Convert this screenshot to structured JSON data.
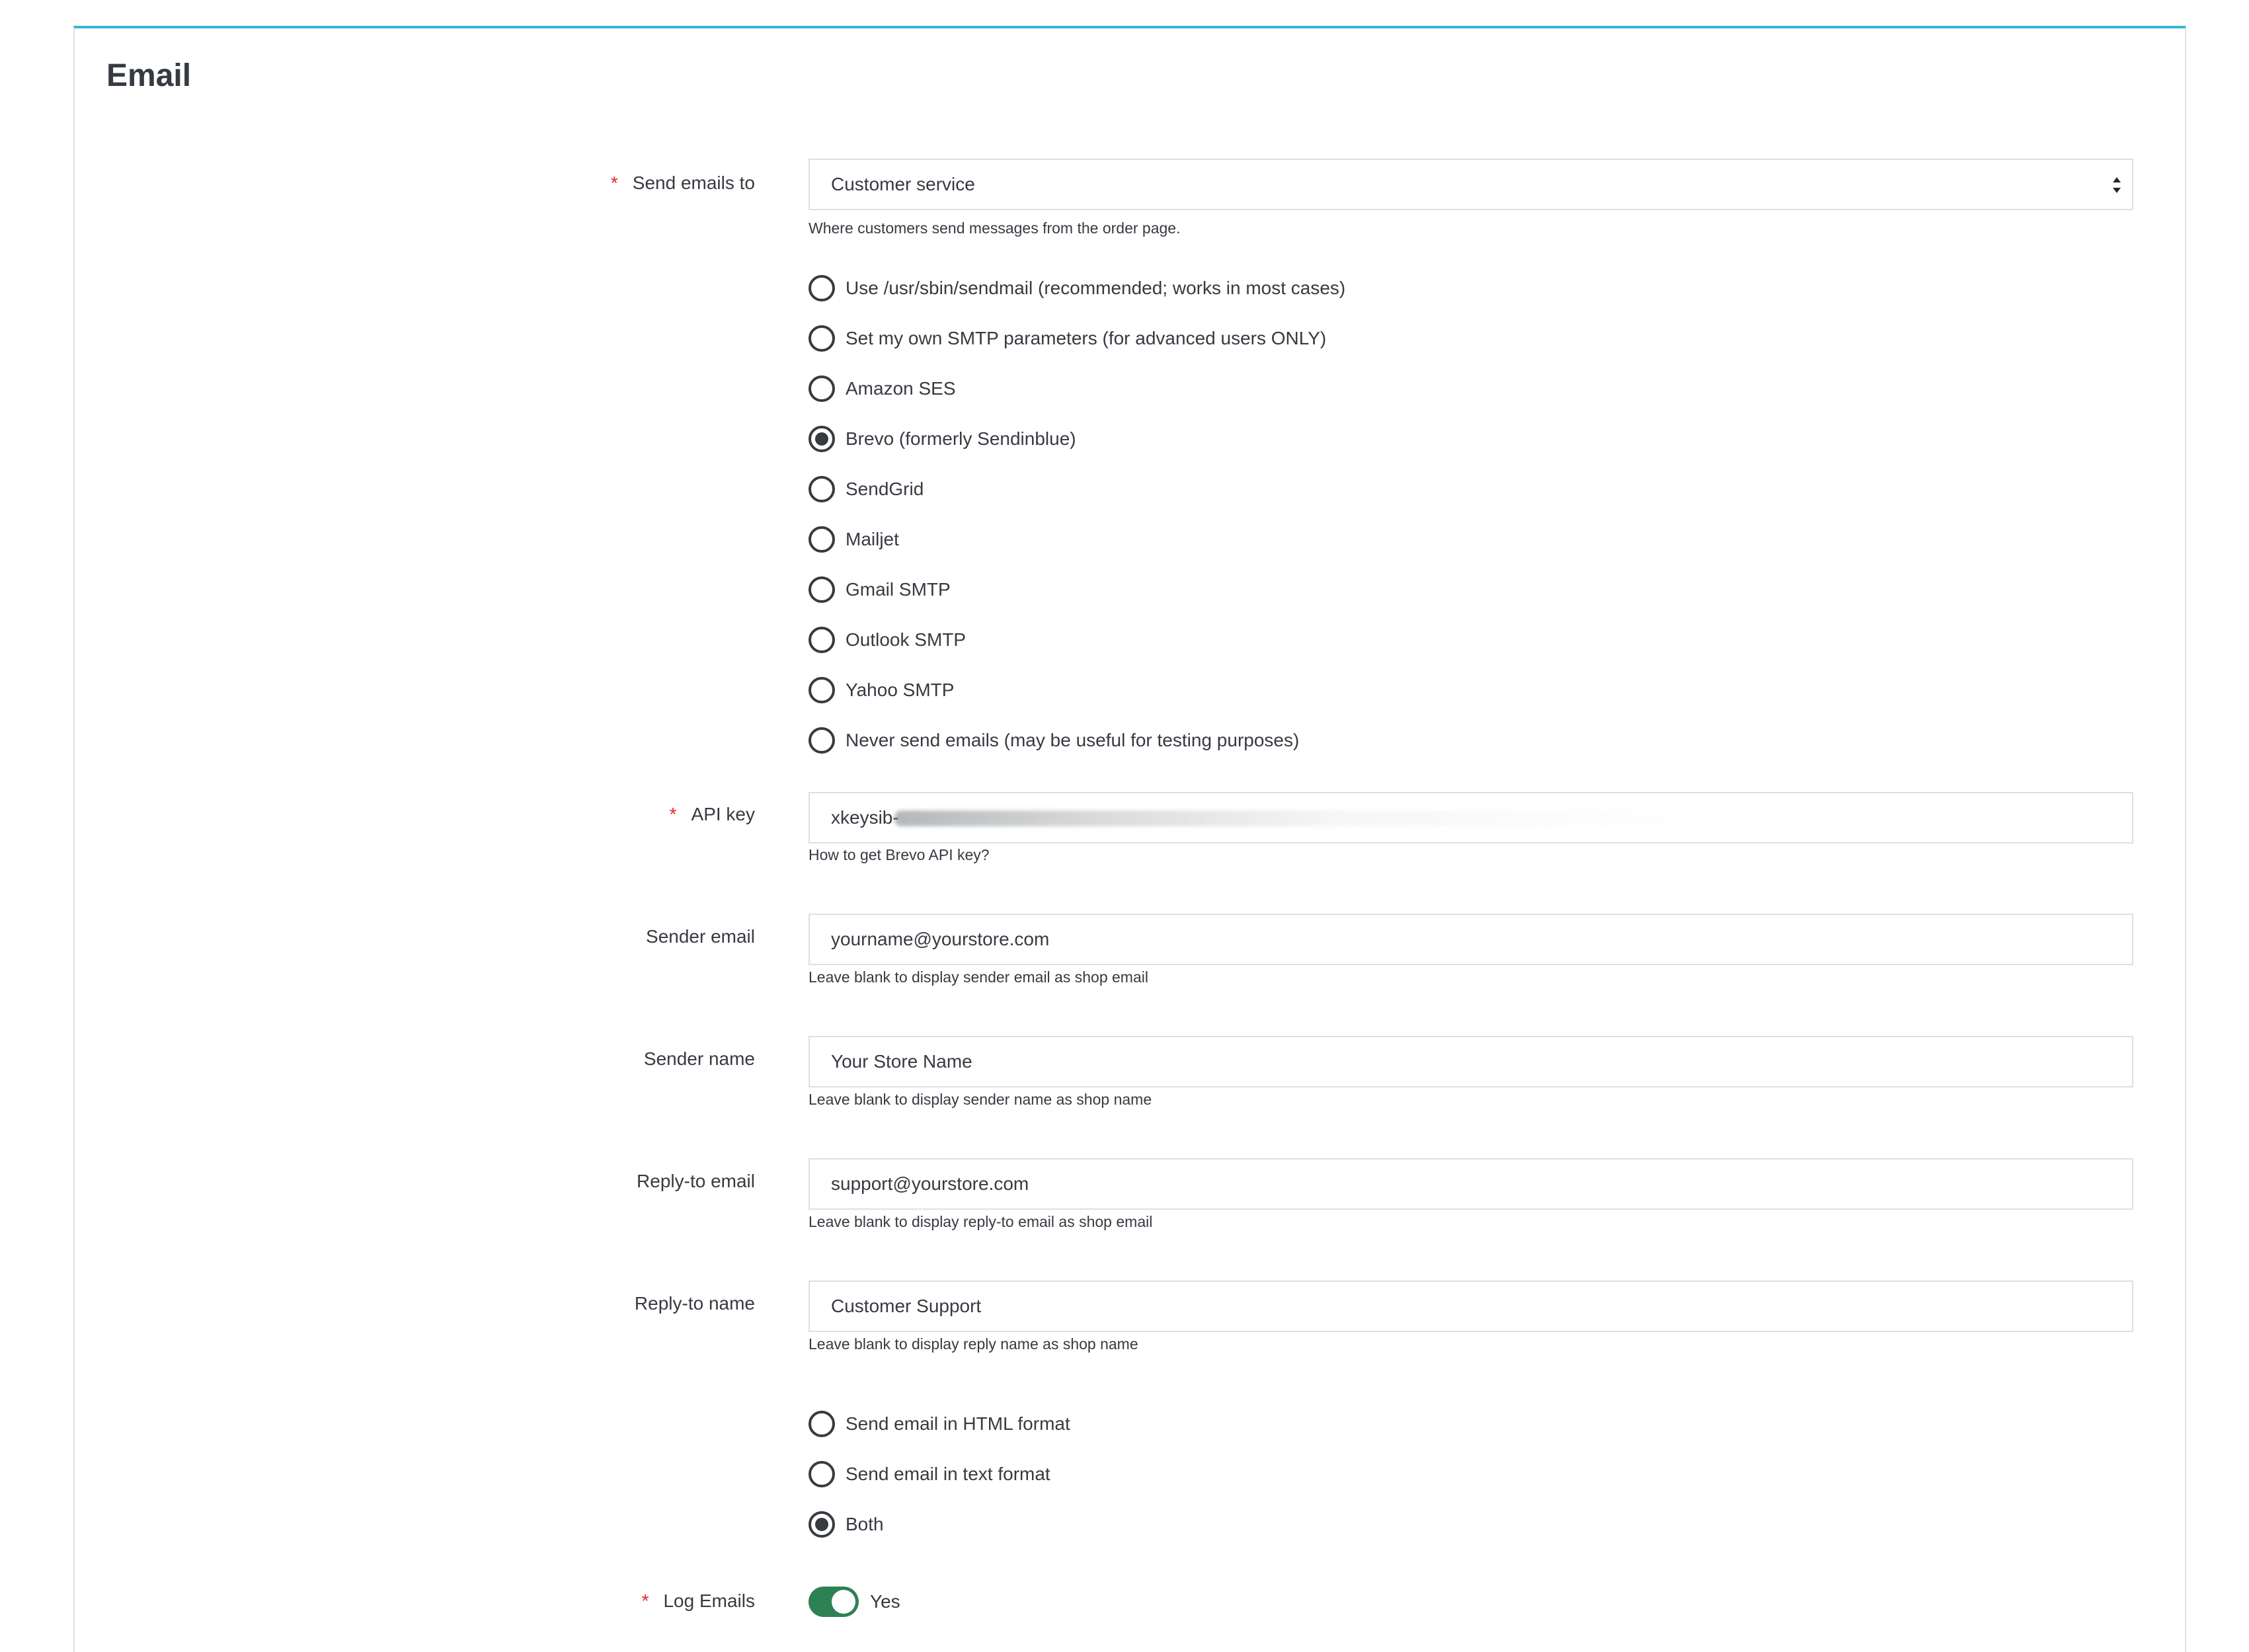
{
  "page": {
    "title": "Email"
  },
  "send_emails_to": {
    "label": "Send emails to",
    "required_mark": "*",
    "value": "Customer service",
    "help": "Where customers send messages from the order page."
  },
  "mail_method": {
    "options": [
      {
        "label": "Use /usr/sbin/sendmail (recommended; works in most cases)",
        "checked": false
      },
      {
        "label": "Set my own SMTP parameters (for advanced users ONLY)",
        "checked": false
      },
      {
        "label": "Amazon SES",
        "checked": false
      },
      {
        "label": "Brevo (formerly Sendinblue)",
        "checked": true
      },
      {
        "label": "SendGrid",
        "checked": false
      },
      {
        "label": "Mailjet",
        "checked": false
      },
      {
        "label": "Gmail SMTP",
        "checked": false
      },
      {
        "label": "Outlook SMTP",
        "checked": false
      },
      {
        "label": "Yahoo SMTP",
        "checked": false
      },
      {
        "label": "Never send emails (may be useful for testing purposes)",
        "checked": false
      }
    ]
  },
  "api_key": {
    "label": "API key",
    "required_mark": "*",
    "value": "xkeysib-",
    "help": "How to get Brevo API key?"
  },
  "sender_email": {
    "label": "Sender email",
    "value": "yourname@yourstore.com",
    "help": "Leave blank to display sender email as shop email"
  },
  "sender_name": {
    "label": "Sender name",
    "value": "Your Store Name",
    "help": "Leave blank to display sender name as shop name"
  },
  "reply_to_email": {
    "label": "Reply-to email",
    "value": "support@yourstore.com",
    "help": "Leave blank to display reply-to email as shop email"
  },
  "reply_to_name": {
    "label": "Reply-to name",
    "value": "Customer Support",
    "help": "Leave blank to display reply name as shop name"
  },
  "email_format": {
    "options": [
      {
        "label": "Send email in HTML format",
        "checked": false
      },
      {
        "label": "Send email in text format",
        "checked": false
      },
      {
        "label": "Both",
        "checked": true
      }
    ]
  },
  "log_emails": {
    "label": "Log Emails",
    "required_mark": "*",
    "state_label": "Yes",
    "enabled": true
  },
  "colors": {
    "accent_top_border": "#3ab5d9",
    "required": "#e3242b",
    "switch_on": "#2c8254",
    "text": "#363a41",
    "input_border": "#dbe0e6"
  }
}
